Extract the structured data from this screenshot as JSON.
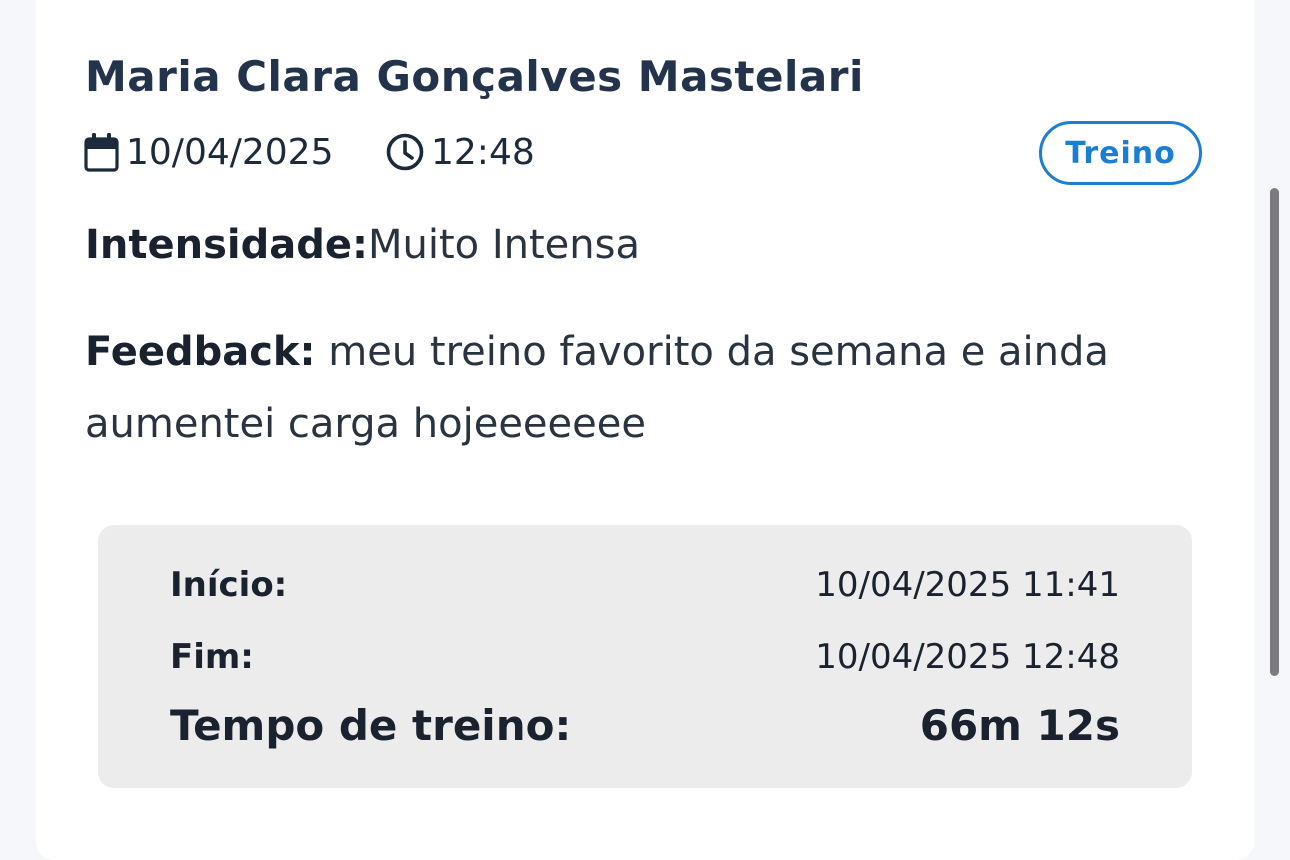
{
  "entry": {
    "name": "Maria Clara Gonçalves Mastelari",
    "date": "10/04/2025",
    "time": "12:48",
    "badge": "Treino",
    "intensity_label": "Intensidade:",
    "intensity_value": "Muito Intensa",
    "feedback_label": "Feedback:",
    "feedback_value": "meu treino favorito da semana e ainda aumentei carga hojeeeeeee"
  },
  "summary": {
    "start_label": "Início:",
    "start_value": "10/04/2025 11:41",
    "end_label": "Fim:",
    "end_value": "10/04/2025 12:48",
    "duration_label": "Tempo de treino:",
    "duration_value": "66m 12s"
  },
  "icons": {
    "date": "calendar-icon",
    "time": "clock-icon"
  },
  "colors": {
    "accent": "#1a7fd4",
    "title": "#22334b",
    "summary_bg": "#ececec"
  }
}
